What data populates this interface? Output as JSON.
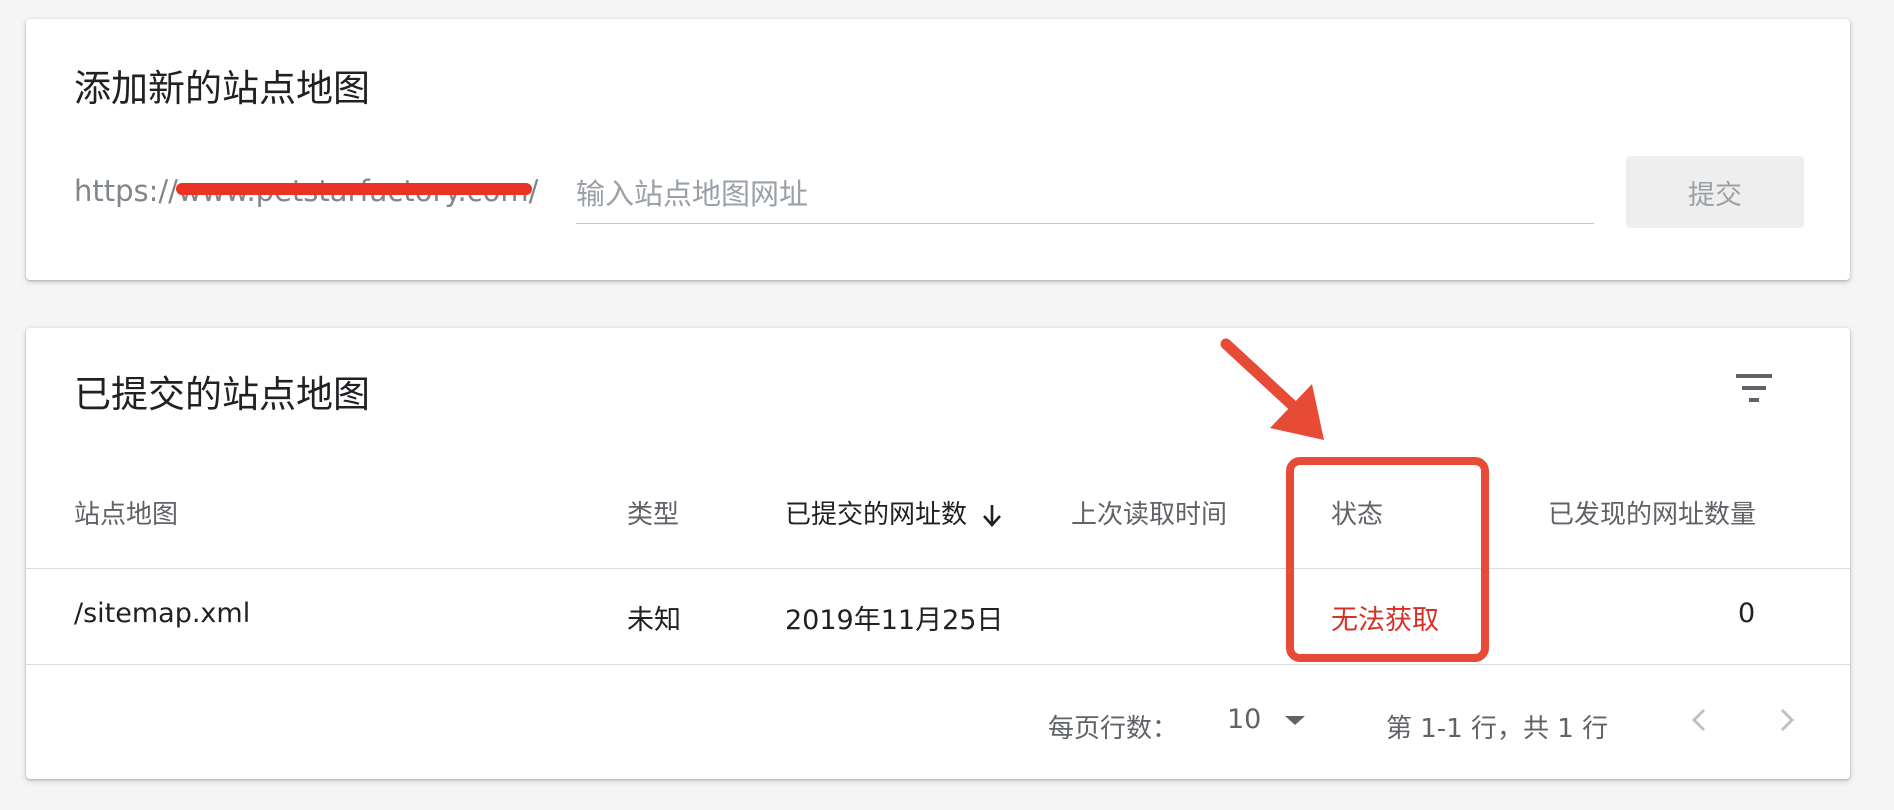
{
  "add_card": {
    "title": "添加新的站点地图",
    "url_prefix": "https://www.petstarfactory.com/",
    "input_placeholder": "输入站点地图网址",
    "submit_label": "提交"
  },
  "list_card": {
    "title": "已提交的站点地图",
    "filter_icon": "filter-list-icon",
    "columns": [
      "站点地图",
      "类型",
      "已提交的网址数",
      "上次读取时间",
      "状态",
      "已发现的网址数量"
    ],
    "sort_icon": "arrow-down-icon",
    "rows": [
      {
        "sitemap": "/sitemap.xml",
        "type": "未知",
        "submitted": "2019年11月25日",
        "last_read": "",
        "status": "无法获取",
        "discovered": "0"
      }
    ],
    "pagination": {
      "rows_per_page_label": "每页行数：",
      "rows_per_page": "10",
      "range": "第 1-1 行，共 1 行"
    }
  },
  "colors": {
    "status_error": "#d93025",
    "annotation": "#e74b35"
  }
}
